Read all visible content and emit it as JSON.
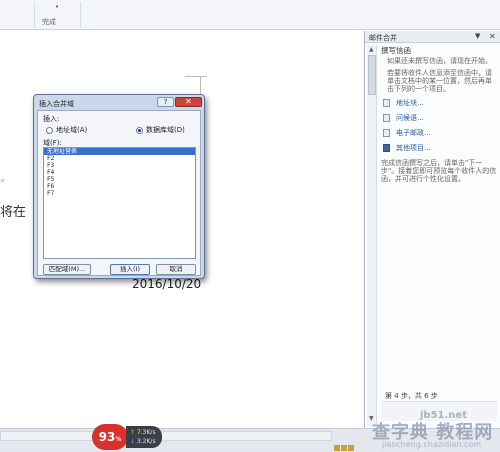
{
  "ribbon": {
    "group_label": "完成",
    "group_icon": "dropdown-dot"
  },
  "document": {
    "visible_text_fragment": "将在",
    "bullet": "◦",
    "date": "2016/10/20"
  },
  "task_pane": {
    "title": "邮件合并",
    "dropdown": "▼",
    "close": "✕",
    "section_heading": "撰写信函",
    "intro": "如果还未撰写信函，请现在开始。",
    "instructions": "若要将收件人信息添至信函中，请单击文档中的某一位置，然后再单击下列的一个项目。",
    "options": [
      {
        "label": "地址块...",
        "icon": "document-icon"
      },
      {
        "label": "问候语...",
        "icon": "document-icon"
      },
      {
        "label": "电子邮政...",
        "icon": "document-icon"
      },
      {
        "label": "其他项目...",
        "icon": "grid-icon"
      }
    ],
    "completion_text": "完成信函撰写之后，请单击\"下一步\"。接着您即可预览每个收件人的信函，并可进行个性化设置。",
    "step_text": "第 4 步，共 6 步"
  },
  "dialog": {
    "title": "插入合并域",
    "help": "?",
    "close": "✕",
    "insert_label": "插入:",
    "radio_address": "地址域(A)",
    "radio_database": "数据库域(D)",
    "selected_radio": "database",
    "field_label": "域(F):",
    "fields": [
      "无地址营表",
      "F2",
      "F3",
      "F4",
      "F5",
      "F6",
      "F7"
    ],
    "selected_field_index": 0,
    "btn_match": "匹配域(M)...",
    "btn_insert": "插入(I)",
    "btn_cancel": "取消"
  },
  "status": {
    "perf_percent": "93",
    "perf_unit": "%",
    "upload_speed": "7.3K/s",
    "download_speed": "3.2K/s"
  },
  "watermark": {
    "line1": "jb51.net",
    "line2": "查字典 教程网",
    "line3": "jiaocheng.chazidian.com"
  },
  "colors": {
    "dialog_bg": "#c9d8ea",
    "selection_blue": "#3a6fd0",
    "close_red": "#c9463c",
    "perf_red": "#d8302b",
    "link_blue": "#2b5aa3"
  }
}
